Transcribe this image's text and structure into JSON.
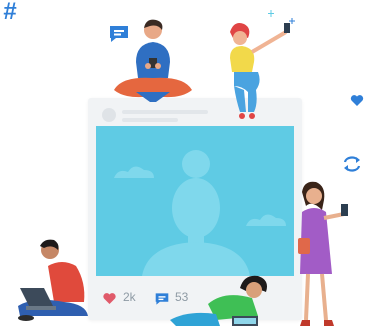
{
  "post": {
    "likes": "2k",
    "comments": "53"
  },
  "colors": {
    "accent_blue": "#2f7fd8",
    "photo_bg": "#5fcbe4",
    "photo_silhouette": "#7fd8ec",
    "heart": "#e05a6a",
    "card_bg": "#f1f3f5"
  },
  "icons": [
    "chat-bubble-icon",
    "hashtag-icon",
    "heart-icon",
    "refresh-icon",
    "like-heart-icon",
    "comment-icon",
    "sparkle-icon"
  ]
}
